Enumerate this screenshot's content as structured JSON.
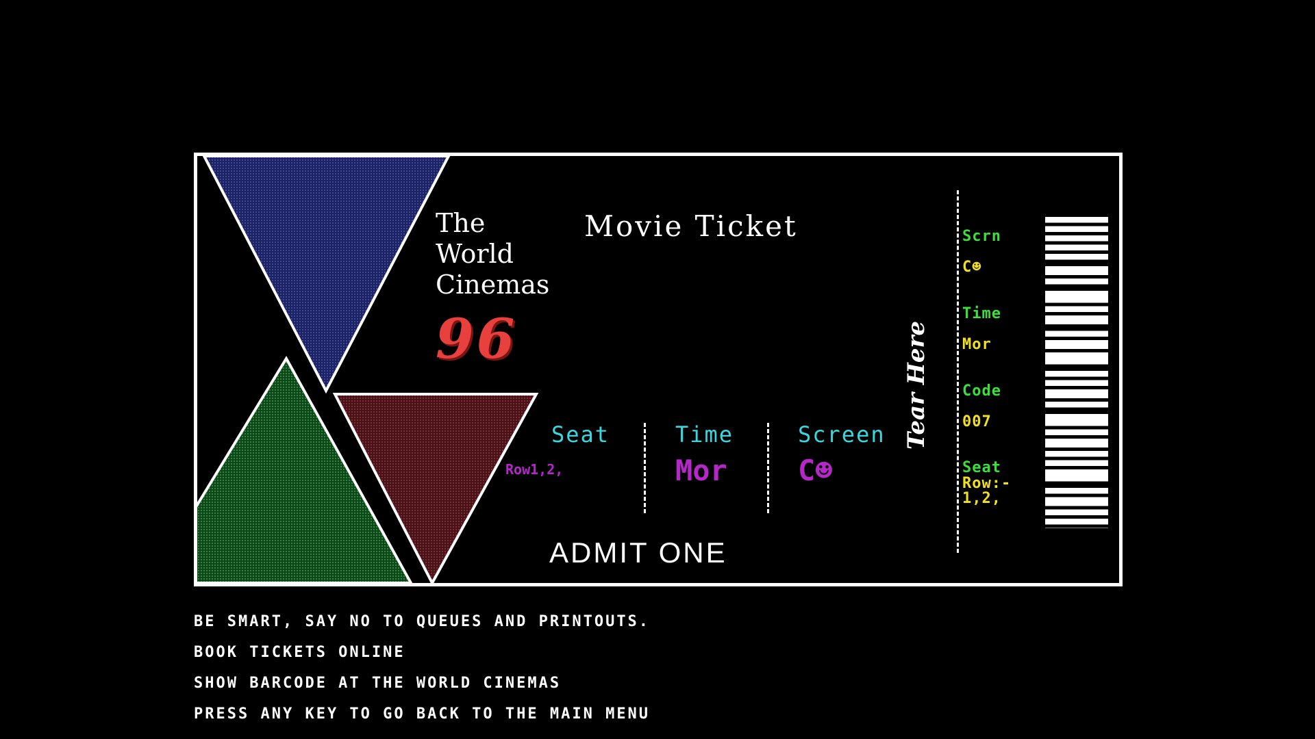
{
  "ticket": {
    "brand_line1": "The",
    "brand_line2": "World",
    "brand_line3": "Cinemas",
    "brand_number": "96",
    "title": "Movie Ticket",
    "seat_label": "Seat",
    "seat_value": "Row1,2,",
    "time_label": "Time",
    "time_value": "Mor",
    "screen_label": "Screen",
    "screen_value": "C☻",
    "admit": "ADMIT ONE",
    "tear_label": "Tear Here"
  },
  "stub": {
    "scrn_label": "Scrn",
    "scrn_value": "C☻",
    "time_label": "Time",
    "time_value": "Mor",
    "code_label": "Code",
    "code_value": "007",
    "seat_label": "Seat",
    "seat_value_line1": "Row:-",
    "seat_value_line2": "1,2,"
  },
  "footer": {
    "line1": "BE SMART, SAY NO TO QUEUES AND PRINTOUTS.",
    "line2": "BOOK TICKETS ONLINE",
    "line3": "SHOW BARCODE AT THE WORLD CINEMAS",
    "line4": "PRESS ANY KEY TO GO BACK TO THE MAIN MENU"
  },
  "colors": {
    "background": "#000000",
    "border": "#ffffff",
    "triangle_blue": "#2e3580",
    "triangle_green": "#1f6b2c",
    "triangle_red": "#6e1f22",
    "brand_number": "#e8403c",
    "field_label": "#38d8e0",
    "field_value": "#b428c8",
    "stub_label": "#3ce03c",
    "stub_value": "#f0e020"
  },
  "icons": {
    "smiley": "smiley-icon"
  }
}
